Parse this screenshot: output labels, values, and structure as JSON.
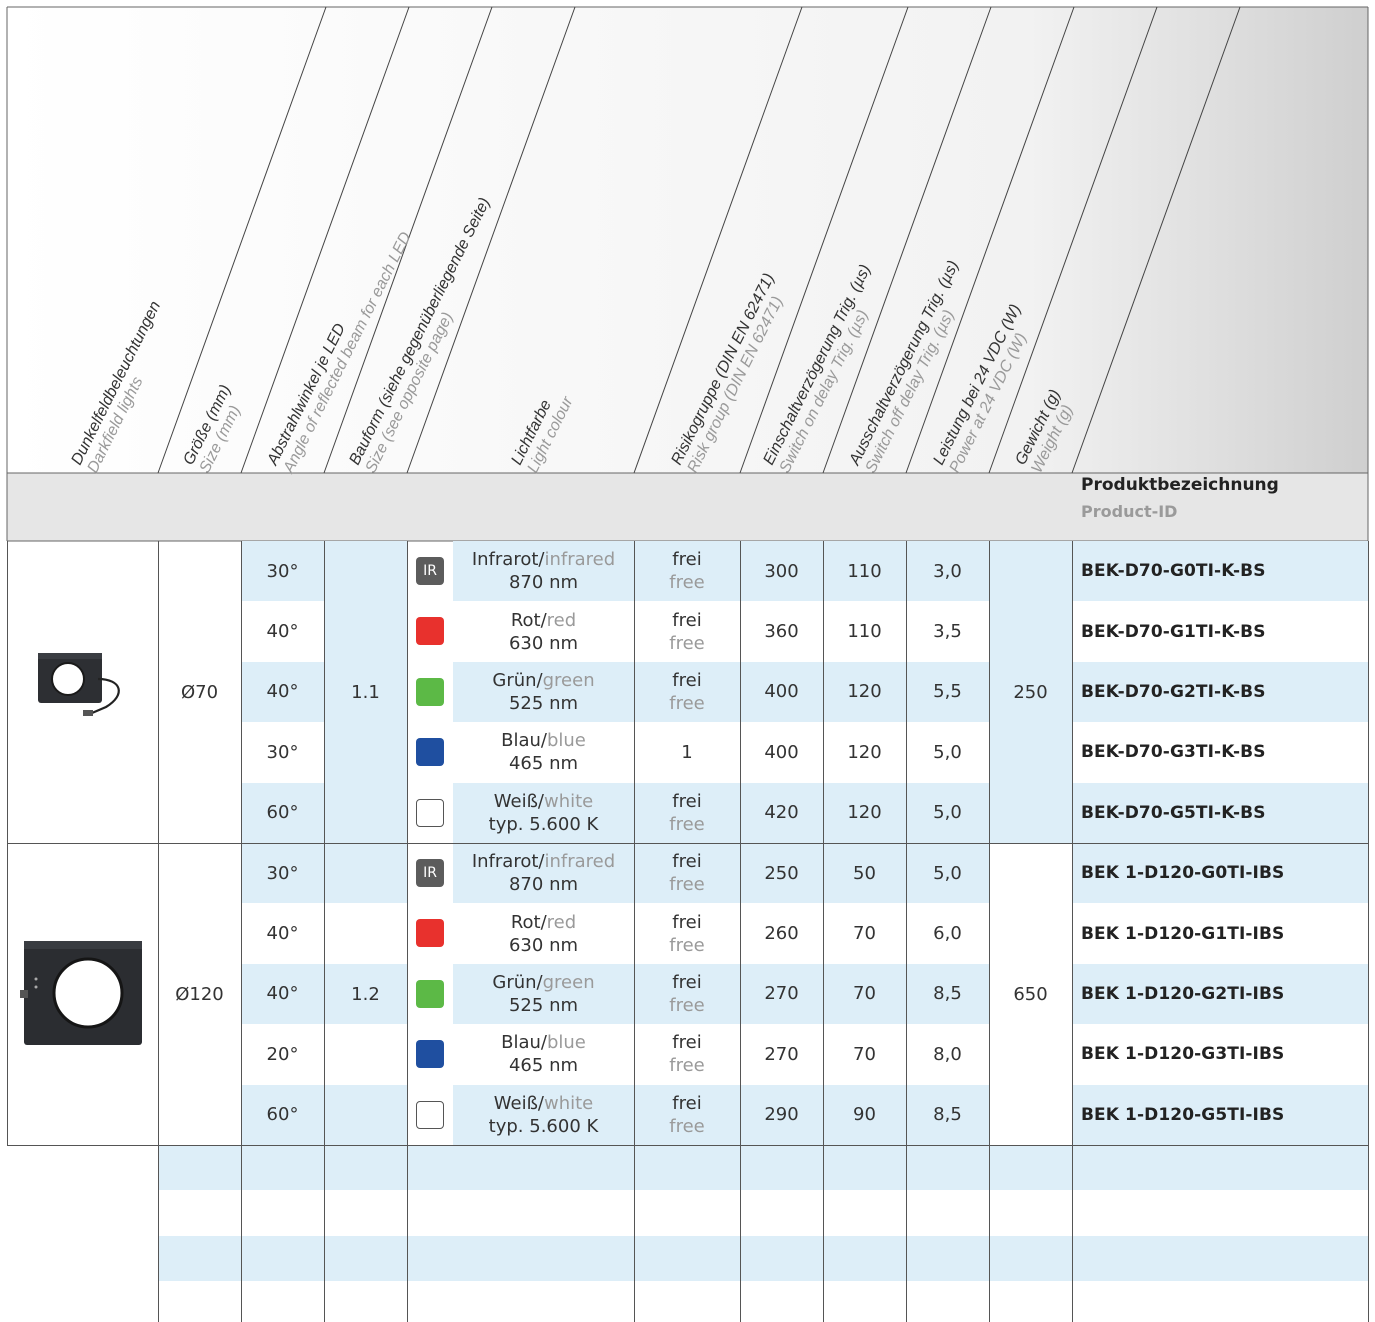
{
  "header": {
    "columns": [
      {
        "de": "Dunkelfeldbeleuchtungen",
        "en": "Darkfield lights"
      },
      {
        "de": "Größe (mm)",
        "en": "Size (mm)"
      },
      {
        "de": "Abstrahlwinkel je LED",
        "en": "Angle of reflected beam for each LED"
      },
      {
        "de": "Bauform (siehe gegenüberliegende Seite)",
        "en": "Size (see opposite page)"
      },
      {
        "de": "Lichtfarbe",
        "en": "Light colour"
      },
      {
        "de": "Risikogruppe (DIN EN 62471)",
        "en": "Risk group (DIN EN 62471)"
      },
      {
        "de": "Einschaltverzögerung Trig. (µs)",
        "en": "Switch on delay Trig. (µs)"
      },
      {
        "de": "Ausschaltverzögerung Trig. (µs)",
        "en": "Switch off delay Trig. (µs)"
      },
      {
        "de": "Leistung bei 24 VDC (W)",
        "en": "Power at 24 VDC (W)"
      },
      {
        "de": "Gewicht (g)",
        "en": "Weight (g)"
      }
    ],
    "product_de": "Produktbezeichnung",
    "product_en": "Product-ID"
  },
  "colors": {
    "band": "#ddeef8",
    "header_gray": "#e6e6e6",
    "infrared": "#5c5c5c",
    "red": "#e8312d",
    "green": "#5cb946",
    "blue": "#1f4fa0",
    "white": "#ffffff"
  },
  "groups": [
    {
      "size": "Ø70",
      "form": "1.1",
      "weight": "250",
      "image": "darkfield-light-d70",
      "rows": [
        {
          "angle": "30°",
          "color": "infrared",
          "swatch": "IR",
          "light_de": "Infrarot",
          "light_en": "infrared",
          "nm": "870 nm",
          "risk_de": "frei",
          "risk_en": "free",
          "on": "300",
          "off": "110",
          "power": "3,0",
          "id": "BEK-D70-G0TI-K-BS"
        },
        {
          "angle": "40°",
          "color": "red",
          "swatch": "",
          "light_de": "Rot",
          "light_en": "red",
          "nm": "630 nm",
          "risk_de": "frei",
          "risk_en": "free",
          "on": "360",
          "off": "110",
          "power": "3,5",
          "id": "BEK-D70-G1TI-K-BS"
        },
        {
          "angle": "40°",
          "color": "green",
          "swatch": "",
          "light_de": "Grün",
          "light_en": "green",
          "nm": "525 nm",
          "risk_de": "frei",
          "risk_en": "free",
          "on": "400",
          "off": "120",
          "power": "5,5",
          "id": "BEK-D70-G2TI-K-BS"
        },
        {
          "angle": "30°",
          "color": "blue",
          "swatch": "",
          "light_de": "Blau",
          "light_en": "blue",
          "nm": "465 nm",
          "risk_de": "1",
          "risk_en": "",
          "on": "400",
          "off": "120",
          "power": "5,0",
          "id": "BEK-D70-G3TI-K-BS"
        },
        {
          "angle": "60°",
          "color": "white",
          "swatch": "",
          "light_de": "Weiß",
          "light_en": "white",
          "nm": "typ. 5.600 K",
          "risk_de": "frei",
          "risk_en": "free",
          "on": "420",
          "off": "120",
          "power": "5,0",
          "id": "BEK-D70-G5TI-K-BS"
        }
      ]
    },
    {
      "size": "Ø120",
      "form": "1.2",
      "weight": "650",
      "image": "darkfield-light-d120",
      "rows": [
        {
          "angle": "30°",
          "color": "infrared",
          "swatch": "IR",
          "light_de": "Infrarot",
          "light_en": "infrared",
          "nm": "870 nm",
          "risk_de": "frei",
          "risk_en": "free",
          "on": "250",
          "off": "50",
          "power": "5,0",
          "id": "BEK 1-D120-G0TI-IBS"
        },
        {
          "angle": "40°",
          "color": "red",
          "swatch": "",
          "light_de": "Rot",
          "light_en": "red",
          "nm": "630 nm",
          "risk_de": "frei",
          "risk_en": "free",
          "on": "260",
          "off": "70",
          "power": "6,0",
          "id": "BEK 1-D120-G1TI-IBS"
        },
        {
          "angle": "40°",
          "color": "green",
          "swatch": "",
          "light_de": "Grün",
          "light_en": "green",
          "nm": "525 nm",
          "risk_de": "frei",
          "risk_en": "free",
          "on": "270",
          "off": "70",
          "power": "8,5",
          "id": "BEK 1-D120-G2TI-IBS"
        },
        {
          "angle": "20°",
          "color": "blue",
          "swatch": "",
          "light_de": "Blau",
          "light_en": "blue",
          "nm": "465 nm",
          "risk_de": "frei",
          "risk_en": "free",
          "on": "270",
          "off": "70",
          "power": "8,0",
          "id": "BEK 1-D120-G3TI-IBS"
        },
        {
          "angle": "60°",
          "color": "white",
          "swatch": "",
          "light_de": "Weiß",
          "light_en": "white",
          "nm": "typ. 5.600 K",
          "risk_de": "frei",
          "risk_en": "free",
          "on": "290",
          "off": "90",
          "power": "8,5",
          "id": "BEK 1-D120-G5TI-IBS"
        }
      ]
    }
  ]
}
